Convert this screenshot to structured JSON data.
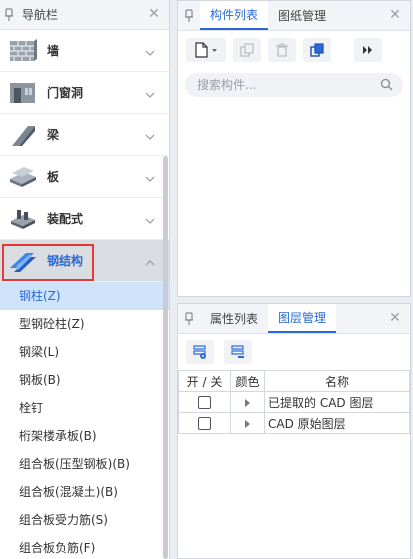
{
  "nav": {
    "title": "导航栏",
    "categories": [
      {
        "label": "墙",
        "icon": "wall-icon"
      },
      {
        "label": "门窗洞",
        "icon": "door-window-icon"
      },
      {
        "label": "梁",
        "icon": "beam-icon"
      },
      {
        "label": "板",
        "icon": "slab-icon"
      },
      {
        "label": "装配式",
        "icon": "prefab-icon"
      },
      {
        "label": "钢结构",
        "icon": "steel-structure-icon"
      }
    ],
    "subitems": [
      "钢柱(Z)",
      "型钢砼柱(Z)",
      "钢梁(L)",
      "钢板(B)",
      "栓钉",
      "桁架楼承板(B)",
      "组合板(压型钢板)(B)",
      "组合板(混凝土)(B)",
      "组合板受力筋(S)",
      "组合板负筋(F)"
    ],
    "selected_index": 0
  },
  "components_panel": {
    "tabs": [
      "构件列表",
      "图纸管理"
    ],
    "active_tab": 0,
    "search_placeholder": "搜索构件..."
  },
  "layer_panel": {
    "tabs": [
      "属性列表",
      "图层管理"
    ],
    "active_tab": 1,
    "columns": [
      "开 / 关",
      "颜色",
      "名称"
    ],
    "rows": [
      {
        "name": "已提取的 CAD 图层"
      },
      {
        "name": "CAD 原始图层"
      }
    ]
  },
  "colors": {
    "accent": "#2a6ad8",
    "highlight_outline": "#e53935",
    "selected_bg": "#cfe3fb"
  }
}
